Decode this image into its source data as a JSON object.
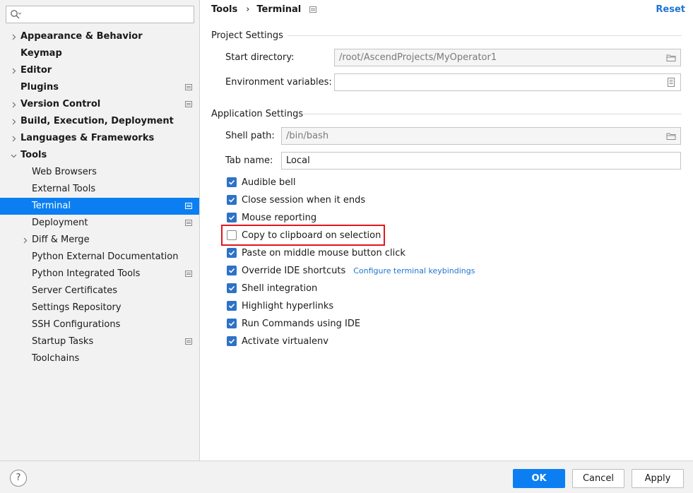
{
  "sidebar": {
    "search_placeholder": "",
    "items": [
      {
        "label": "Appearance & Behavior",
        "expandable": true,
        "expanded": false,
        "bold": true
      },
      {
        "label": "Keymap",
        "bold": true
      },
      {
        "label": "Editor",
        "expandable": true,
        "expanded": false,
        "bold": true
      },
      {
        "label": "Plugins",
        "bold": true,
        "project_icon": true
      },
      {
        "label": "Version Control",
        "expandable": true,
        "expanded": false,
        "bold": true,
        "project_icon": true
      },
      {
        "label": "Build, Execution, Deployment",
        "expandable": true,
        "expanded": false,
        "bold": true
      },
      {
        "label": "Languages & Frameworks",
        "expandable": true,
        "expanded": false,
        "bold": true
      },
      {
        "label": "Tools",
        "expandable": true,
        "expanded": true,
        "bold": true
      },
      {
        "label": "Web Browsers"
      },
      {
        "label": "External Tools"
      },
      {
        "label": "Terminal",
        "selected": true,
        "project_icon": true
      },
      {
        "label": "Deployment",
        "project_icon": true
      },
      {
        "label": "Diff & Merge",
        "expandable": true,
        "expanded": false
      },
      {
        "label": "Python External Documentation"
      },
      {
        "label": "Python Integrated Tools",
        "project_icon": true
      },
      {
        "label": "Server Certificates"
      },
      {
        "label": "Settings Repository"
      },
      {
        "label": "SSH Configurations"
      },
      {
        "label": "Startup Tasks",
        "project_icon": true
      },
      {
        "label": "Toolchains"
      }
    ]
  },
  "header": {
    "breadcrumb_parent": "Tools",
    "breadcrumb_separator": "›",
    "breadcrumb_current": "Terminal",
    "reset_label": "Reset"
  },
  "project_settings": {
    "title": "Project Settings",
    "start_directory_label": "Start directory:",
    "start_directory_value": "/root/AscendProjects/MyOperator1",
    "env_vars_label": "Environment variables:",
    "env_vars_value": ""
  },
  "application_settings": {
    "title": "Application Settings",
    "shell_path_label": "Shell path:",
    "shell_path_value": "/bin/bash",
    "tab_name_label": "Tab name:",
    "tab_name_value": "Local",
    "checkboxes": [
      {
        "label": "Audible bell",
        "checked": true
      },
      {
        "label": "Close session when it ends",
        "checked": true
      },
      {
        "label": "Mouse reporting",
        "checked": true
      },
      {
        "label": "Copy to clipboard on selection",
        "checked": false
      },
      {
        "label": "Paste on middle mouse button click",
        "checked": true
      },
      {
        "label": "Override IDE shortcuts",
        "checked": true,
        "link": "Configure terminal keybindings"
      },
      {
        "label": "Shell integration",
        "checked": true
      },
      {
        "label": "Highlight hyperlinks",
        "checked": true
      },
      {
        "label": "Run Commands using IDE",
        "checked": true
      },
      {
        "label": "Activate virtualenv",
        "checked": true
      }
    ]
  },
  "footer": {
    "help_label": "?",
    "ok_label": "OK",
    "cancel_label": "Cancel",
    "apply_label": "Apply"
  },
  "colors": {
    "accent": "#0b7ff2",
    "link": "#1f74d4",
    "highlight": "#e2161e"
  }
}
